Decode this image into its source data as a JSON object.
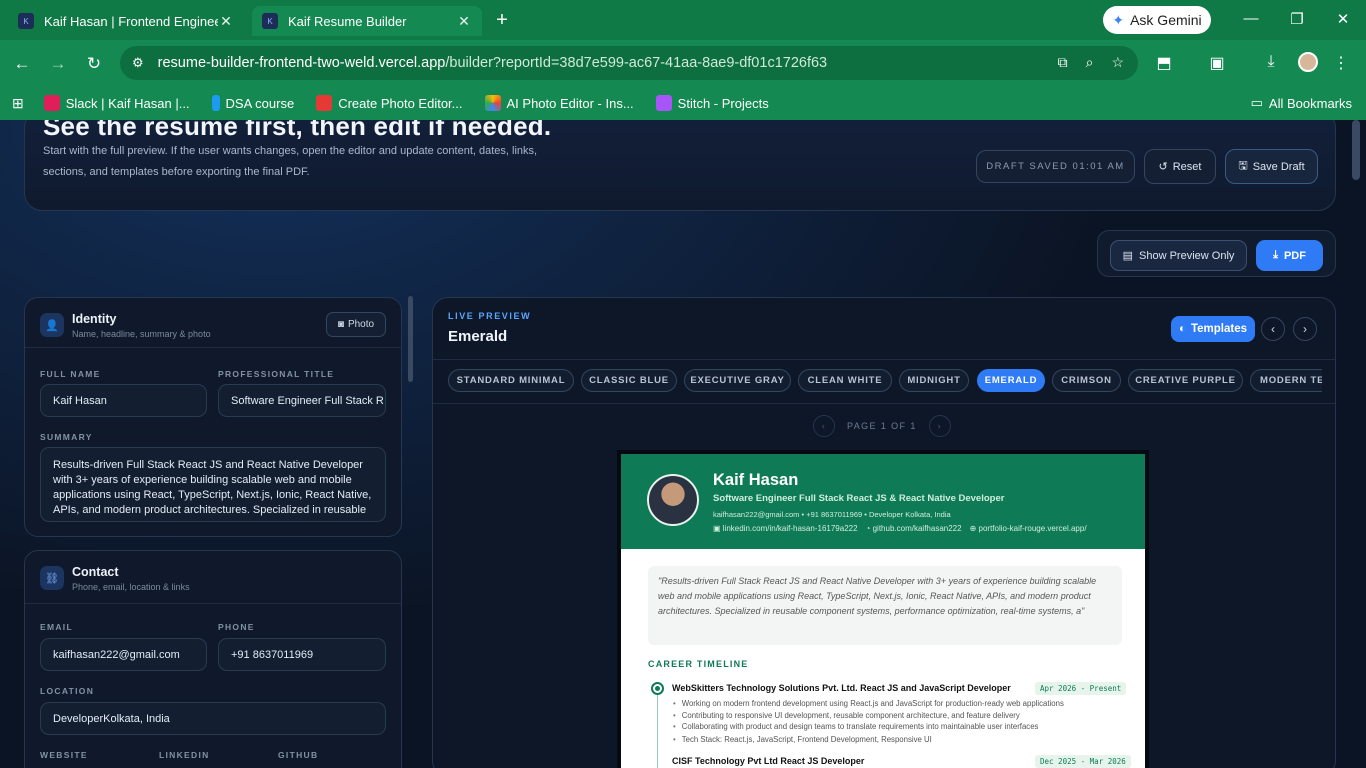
{
  "browser": {
    "tabs": [
      {
        "title": "Kaif Hasan | Frontend Engineer",
        "active": false
      },
      {
        "title": "Kaif Resume Builder",
        "active": true
      }
    ],
    "ask_gemini": "Ask Gemini",
    "url_host": "resume-builder-frontend-two-weld.vercel.app",
    "url_path": "/builder?reportId=38d7e599-ac67-41aa-8ae9-df01c1726f63",
    "bookmarks": [
      {
        "label": "Slack | Kaif Hasan |...",
        "color": "#e01e5a"
      },
      {
        "label": "DSA course",
        "color": "#1d9bf0"
      },
      {
        "label": "Create Photo Editor...",
        "color": "#e53935"
      },
      {
        "label": "AI Photo Editor - Ins...",
        "color": "#fbbc05"
      },
      {
        "label": "Stitch - Projects",
        "color": "#a855f7"
      }
    ],
    "all_bookmarks": "All Bookmarks"
  },
  "hero": {
    "title": "See the resume first, then edit if needed.",
    "description": "Start with the full preview. If the user wants changes, open the editor and update content, dates, links, sections, and templates before exporting the final PDF.",
    "draft_status": "DRAFT SAVED 01:01 AM",
    "reset_label": "Reset",
    "save_label": "Save Draft"
  },
  "actions": {
    "show_preview": "Show Preview Only",
    "pdf": "PDF"
  },
  "identity": {
    "title": "Identity",
    "subtitle": "Name, headline, summary & photo",
    "photo_label": "Photo",
    "full_name_label": "FULL NAME",
    "full_name": "Kaif Hasan",
    "title_label": "PROFESSIONAL TITLE",
    "professional_title": "Software Engineer Full Stack R",
    "summary_label": "SUMMARY",
    "summary": "Results-driven Full Stack React JS and React Native Developer with 3+ years of experience building scalable web and mobile applications using React, TypeScript, Next.js, Ionic, React Native, APIs, and modern product architectures. Specialized in reusable"
  },
  "contact": {
    "title": "Contact",
    "subtitle": "Phone, email, location & links",
    "email_label": "EMAIL",
    "email": "kaifhasan222@gmail.com",
    "phone_label": "PHONE",
    "phone": "+91 8637011969",
    "location_label": "LOCATION",
    "location": "DeveloperKolkata, India",
    "website_label": "WEBSITE",
    "linkedin_label": "LINKEDIN",
    "github_label": "GITHUB"
  },
  "preview": {
    "eyebrow": "LIVE PREVIEW",
    "template_name": "Emerald",
    "templates_btn": "Templates",
    "chips": [
      "STANDARD MINIMAL",
      "CLASSIC BLUE",
      "EXECUTIVE GRAY",
      "CLEAN WHITE",
      "MIDNIGHT",
      "EMERALD",
      "CRIMSON",
      "CREATIVE PURPLE",
      "MODERN TE"
    ],
    "selected_chip": "EMERALD",
    "page_indicator": "PAGE 1 OF 1"
  },
  "resume": {
    "name": "Kaif Hasan",
    "role": "Software Engineer Full Stack React JS & React Native Developer",
    "contact": "kaifhasan222@gmail.com • +91 8637011969 • Developer Kolkata, India",
    "linkedin": "linkedin.com/in/kaif-hasan-16179a222",
    "github": "github.com/kaifhasan222",
    "portfolio": "portfolio-kaif-rouge.vercel.app/",
    "summary": "\"Results-driven Full Stack React JS and React Native Developer with 3+ years of experience building scalable web and mobile applications using React, TypeScript, Next.js, Ionic, React Native, APIs, and modern product architectures. Specialized in reusable component systems, performance optimization, real-time systems, a\"",
    "section": "CAREER TIMELINE",
    "job1_title": "WebSkitters Technology Solutions Pvt. Ltd. React JS and JavaScript Developer",
    "job1_date": "Apr 2026 - Present",
    "job1_bullets": [
      "Working on modern frontend development using React.js and JavaScript for production-ready web applications",
      "Contributing to responsive UI development, reusable component architecture, and feature delivery",
      "Collaborating with product and design teams to translate requirements into maintainable user interfaces",
      "Tech Stack: React.js, JavaScript, Frontend Development, Responsive UI"
    ],
    "job2_title": "CISF Technology Pvt Ltd React JS Developer",
    "job2_date": "Dec 2025 - Mar 2026"
  }
}
